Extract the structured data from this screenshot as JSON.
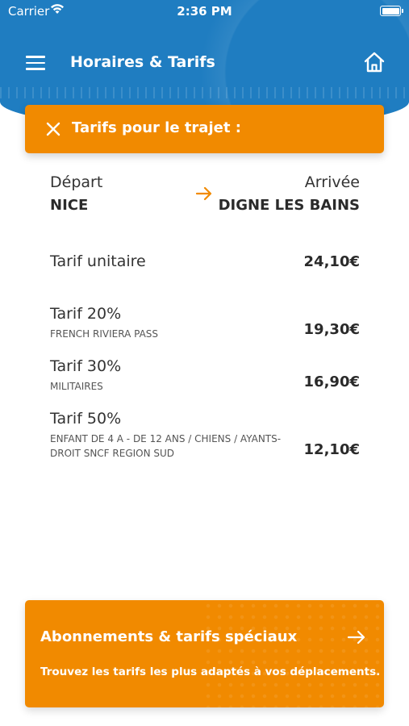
{
  "status_bar": {
    "carrier": "Carrier",
    "time": "2:36 PM"
  },
  "header": {
    "title": "Horaires & Tarifs",
    "menu_icon": "hamburger-menu-icon",
    "home_icon": "home-icon",
    "color": "#1f7dc1"
  },
  "banner": {
    "title": "Tarifs pour le trajet :",
    "close_icon": "close-icon",
    "color": "#f18a00"
  },
  "route": {
    "departure_label": "Départ",
    "departure_name": "NICE",
    "arrival_label": "Arrivée",
    "arrival_name": "DIGNE LES BAINS",
    "arrow_icon": "arrow-right-icon"
  },
  "fares": [
    {
      "name": "Tarif unitaire",
      "sub": "",
      "price": "24,10€"
    },
    {
      "name": "Tarif 20%",
      "sub": "FRENCH RIVIERA PASS",
      "price": "19,30€"
    },
    {
      "name": "Tarif 30%",
      "sub": "MILITAIRES",
      "price": "16,90€"
    },
    {
      "name": "Tarif 50%",
      "sub": "ENFANT DE 4  A - DE 12 ANS / CHIENS / AYANTS-DROIT SNCF REGION SUD",
      "price": "12,10€"
    }
  ],
  "promo": {
    "title": "Abonnements & tarifs spéciaux",
    "description": "Trouvez les tarifs les plus adaptés à vos déplacements.",
    "arrow_icon": "arrow-right-icon"
  }
}
